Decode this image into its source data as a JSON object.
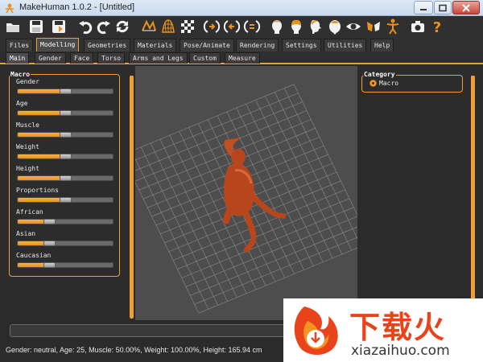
{
  "window": {
    "title": "MakeHuman 1.0.2 - [Untitled]"
  },
  "toolbar": {
    "icons": [
      "open-icon",
      "save-icon",
      "export-icon",
      "undo-icon",
      "redo-icon",
      "reset-icon",
      "wireframe-icon",
      "smooth-icon",
      "background-icon",
      "front-view-icon",
      "back-view-icon",
      "side-view-icon",
      "head-front-icon",
      "head-back-icon",
      "head-side-icon",
      "head-top-icon",
      "eye-icon",
      "hands-icon",
      "skeleton-icon",
      "camera-icon",
      "help-icon"
    ]
  },
  "main_tabs": [
    "Files",
    "Modelling",
    "Geometries",
    "Materials",
    "Pose/Animate",
    "Rendering",
    "Settings",
    "Utilities",
    "Help"
  ],
  "sub_tabs": [
    "Main",
    "Gender",
    "Face",
    "Torso",
    "Arms and Legs",
    "Custom",
    "Measure"
  ],
  "macro": {
    "title": "Macro",
    "sliders": [
      {
        "label": "Gender",
        "value": 0.5
      },
      {
        "label": "Age",
        "value": 0.5
      },
      {
        "label": "Muscle",
        "value": 0.5
      },
      {
        "label": "Weight",
        "value": 0.5
      },
      {
        "label": "Height",
        "value": 0.5
      },
      {
        "label": "Proportions",
        "value": 0.5
      },
      {
        "label": "African",
        "value": 0.33
      },
      {
        "label": "Asian",
        "value": 0.33
      },
      {
        "label": "Caucasian",
        "value": 0.33
      }
    ]
  },
  "category": {
    "title": "Category",
    "option": "Macro"
  },
  "status": {
    "text": "Gender: neutral, Age: 25, Muscle: 50.00%, Weight: 100.00%, Height: 165.94 cm"
  },
  "watermark": {
    "cn": "下载火",
    "url": "xiazaihuo.com"
  },
  "colors": {
    "accent": "#f0a030",
    "model": "#b8461c",
    "viewport": "#4d4d4d"
  }
}
